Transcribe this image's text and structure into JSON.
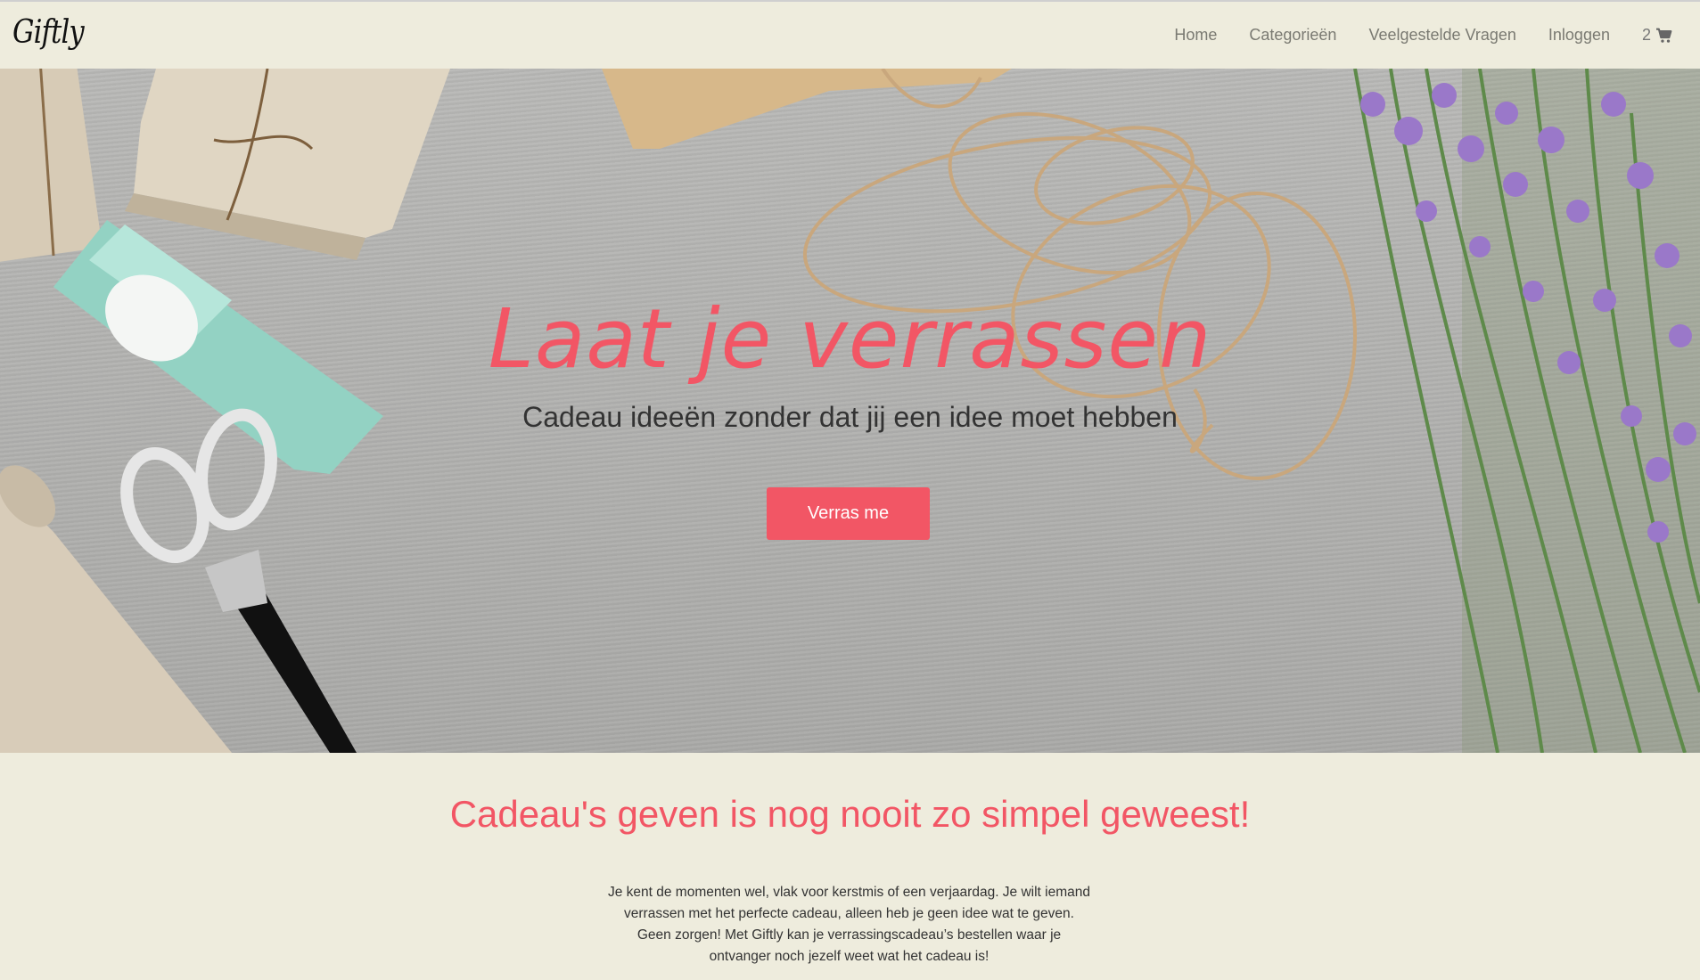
{
  "brand": {
    "logo_text": "Giftly"
  },
  "nav": {
    "items": [
      {
        "label": "Home"
      },
      {
        "label": "Categorieën"
      },
      {
        "label": "Veelgestelde Vragen"
      },
      {
        "label": "Inloggen"
      }
    ],
    "cart_count": "2",
    "cart_icon": "shopping-cart-icon"
  },
  "hero": {
    "title": "Laat je verrassen",
    "subtitle": "Cadeau ideeën zonder dat jij een idee moet hebben",
    "cta_label": "Verras me"
  },
  "intro": {
    "heading": "Cadeau's geven is nog nooit zo simpel geweest!",
    "body": "Je kent de momenten wel, vlak voor kerstmis of een verjaardag. Je wilt iemand verrassen met het perfecte cadeau, alleen heb je geen idee wat te geven. Geen zorgen! Met Giftly kan je verrassingscadeau’s bestellen waar je ontvanger noch jezelf weet wat het cadeau is!"
  },
  "colors": {
    "accent": "#f25665",
    "background": "#eeecdd",
    "nav_text": "#7a7a72"
  }
}
